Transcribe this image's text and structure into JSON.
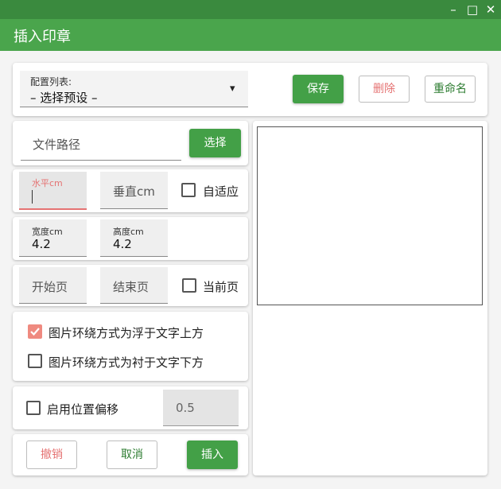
{
  "window": {
    "title": "插入印章",
    "minimize_glyph": "–",
    "maximize_glyph": "□",
    "close_glyph": "✕"
  },
  "config": {
    "label": "配置列表:",
    "selected": "– 选择预设 –",
    "dropdown_glyph": "▾",
    "save_label": "保存",
    "delete_label": "删除",
    "rename_label": "重命名"
  },
  "file": {
    "path_placeholder": "文件路径",
    "choose_label": "选择"
  },
  "position": {
    "horizontal_label": "水平cm",
    "horizontal_value": "",
    "vertical_placeholder": "垂直cm",
    "adaptive_label": "自适应",
    "adaptive_checked": false
  },
  "size": {
    "width_label": "宽度cm",
    "width_value": "4.2",
    "height_label": "高度cm",
    "height_value": "4.2"
  },
  "pages": {
    "start_placeholder": "开始页",
    "end_placeholder": "结束页",
    "current_label": "当前页",
    "current_checked": false
  },
  "wrap": {
    "float_label": "图片环绕方式为浮于文字上方",
    "float_checked": true,
    "behind_label": "图片环绕方式为衬于文字下方",
    "behind_checked": false
  },
  "offset": {
    "enable_label": "启用位置偏移",
    "enable_checked": false,
    "value": "0.5"
  },
  "actions": {
    "undo_label": "撤销",
    "cancel_label": "取消",
    "insert_label": "插入"
  },
  "colors": {
    "primary": "#43a047",
    "titlebar": "#4aa54c",
    "accent_red": "#e57373"
  }
}
